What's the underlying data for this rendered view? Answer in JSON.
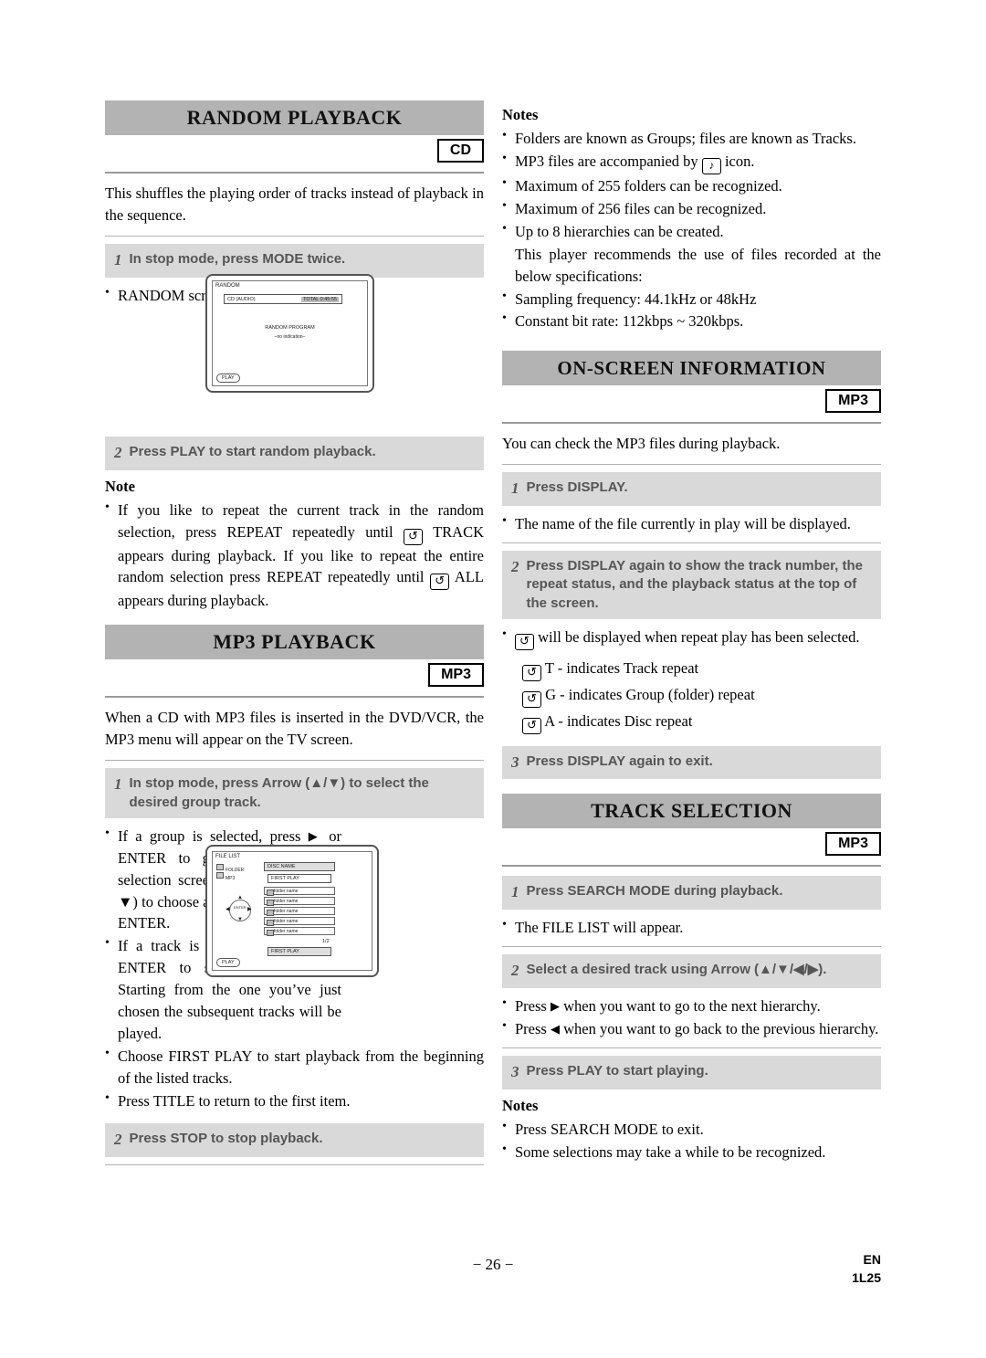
{
  "page": {
    "number": "− 26 −",
    "lang_code": "EN",
    "doc_code": "1L25"
  },
  "left_column": {
    "random_playback": {
      "title": "RANDOM PLAYBACK",
      "badge": "CD",
      "intro": "This shuffles the playing order of tracks instead of playback in the sequence.",
      "step1_num": "1",
      "step1_text": "In stop mode, press MODE twice.",
      "bullet1": "RANDOM screen appears.",
      "figure": {
        "label": "RANDOM",
        "box_left": "CD (AUDIO)",
        "box_right": "TOTAL 0:45:55",
        "center_line1": "RANDOM PROGRAM",
        "center_line2": "–no indication–",
        "play": "PLAY"
      },
      "step2_num": "2",
      "step2_text": "Press PLAY to start random playback.",
      "note_heading": "Note",
      "note_text_a": "If you like to repeat the current track in the random selection, press REPEAT repeatedly until",
      "note_text_b": "TRACK appears during playback. If you like to repeat the entire random selection press REPEAT repeatedly until",
      "note_text_c": "ALL appears during playback."
    },
    "mp3_playback": {
      "title": "MP3 PLAYBACK",
      "badge": "MP3",
      "intro": "When a CD with MP3 files is inserted in the DVD/VCR, the MP3 menu will appear on the TV screen.",
      "step1_num": "1",
      "step1_text": "In stop mode, press Arrow (▲/▼) to select the desired group track.",
      "bullet1_a": "If a group is selected, press",
      "bullet1_b": "or ENTER to go on to the track selection screen. Press Arrow (▲/▼) to choose a track, then press",
      "bullet1_c": "or ENTER.",
      "bullet2_a": "If a track is selected, press",
      "bullet2_b": "or ENTER to start playing tracks. Starting from the one you’ve just chosen the subsequent tracks will be played.",
      "bullet3": "Choose FIRST PLAY to start playback from the beginning of the listed tracks.",
      "bullet4": "Press TITLE to return to the first item.",
      "figure": {
        "label": "FILE LIST",
        "side_folder": "FOLDER",
        "side_mp3": "MP3",
        "disc_name": "DISC NAME",
        "first_play_top": "FIRST PLAY",
        "rows": [
          "folder name",
          "folder name",
          "folder name",
          "folder name",
          "folder name"
        ],
        "page_indicator": "1/2",
        "first_play_bottom": "FIRST PLAY",
        "play": "PLAY",
        "enter": "ENTER"
      },
      "step2_num": "2",
      "step2_text": "Press STOP to stop playback."
    }
  },
  "right_column": {
    "notes_top": {
      "heading": "Notes",
      "items": [
        "Folders are known as Groups; files are known as Tracks.",
        "MP3 files are accompanied by  icon.",
        "Maximum of 255 folders can be recognized.",
        "Maximum of 256 files can be recognized.",
        "Up to 8 hierarchies can be created.",
        "Sampling frequency: 44.1kHz or 48kHz",
        "Constant bit rate: 112kbps ~ 320kbps."
      ],
      "item2_a": "MP3 files are accompanied by",
      "item2_b": "icon.",
      "item5_cont": "This player recommends the use of files recorded at the below specifications:"
    },
    "on_screen_information": {
      "title": "ON-SCREEN INFORMATION",
      "badge": "MP3",
      "intro": "You can check the MP3 files during playback.",
      "step1_num": "1",
      "step1_text": "Press DISPLAY.",
      "bullet1": "The name of the file currently in play will be displayed.",
      "step2_num": "2",
      "step2_text": "Press DISPLAY again to show the track number, the repeat status, and the playback status at the top of the screen.",
      "bullet2": "will be displayed when repeat play has been selected.",
      "repeat_t": "T - indicates Track repeat",
      "repeat_g": "G - indicates Group (folder) repeat",
      "repeat_a": "A - indicates Disc repeat",
      "step3_num": "3",
      "step3_text": "Press DISPLAY again to exit."
    },
    "track_selection": {
      "title": "TRACK SELECTION",
      "badge": "MP3",
      "step1_num": "1",
      "step1_text": "Press SEARCH MODE during playback.",
      "bullet1": "The FILE LIST will appear.",
      "step2_num": "2",
      "step2_text": "Select a desired track using Arrow (▲/▼/◀/▶).",
      "bullet2_a": "Press",
      "bullet2_b": "when you want to go to the next hierarchy.",
      "bullet3_a": "Press",
      "bullet3_b": "when you want to go back to the previous hierarchy.",
      "step3_num": "3",
      "step3_text": "Press PLAY to start playing.",
      "notes_heading": "Notes",
      "note1": "Press SEARCH MODE to exit.",
      "note2": "Some selections may take a while to be recognized."
    }
  }
}
